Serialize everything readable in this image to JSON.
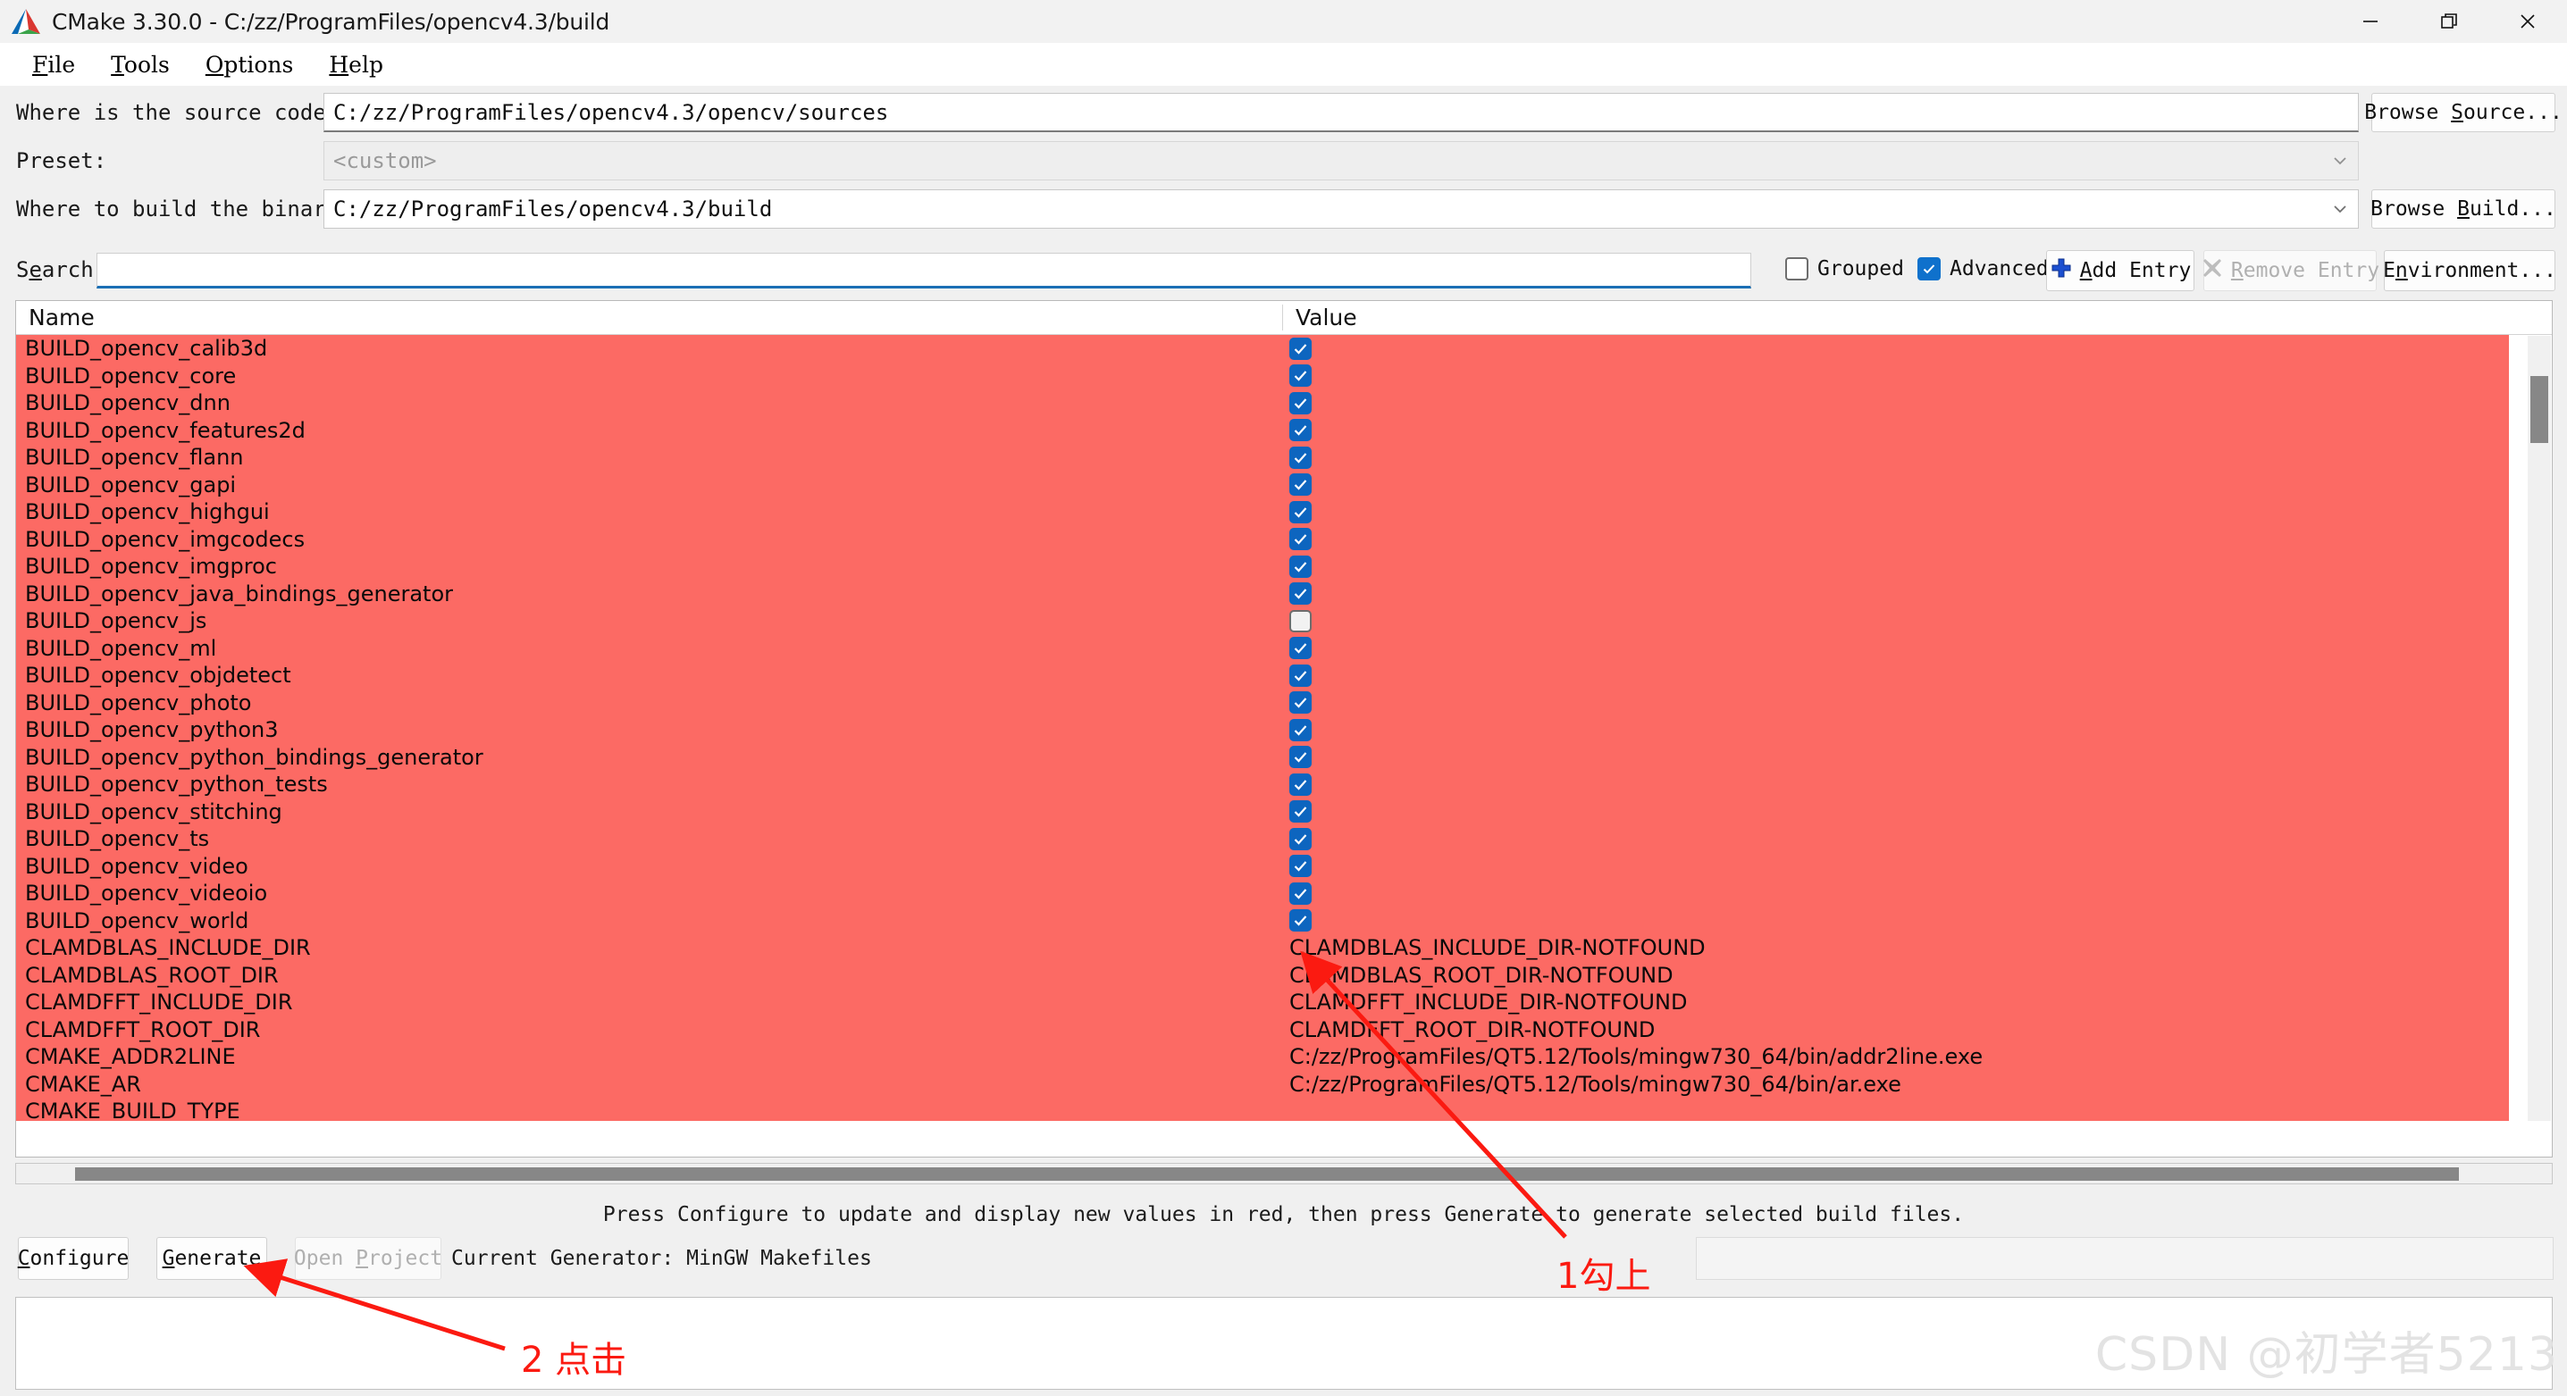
{
  "window": {
    "title": "CMake 3.30.0 - C:/zz/ProgramFiles/opencv4.3/build",
    "logo_icon": "cmake-logo-icon",
    "minimize_icon": "minimize-icon",
    "maximize_icon": "restore-icon",
    "close_icon": "close-icon"
  },
  "menu": {
    "items": [
      {
        "label": "File",
        "mnemonic": "F"
      },
      {
        "label": "Tools",
        "mnemonic": "T"
      },
      {
        "label": "Options",
        "mnemonic": "O"
      },
      {
        "label": "Help",
        "mnemonic": "H"
      }
    ]
  },
  "form": {
    "source_label": "Where is the source code:",
    "source_value": "C:/zz/ProgramFiles/opencv4.3/opencv/sources",
    "browse_source_label": "Browse Source...",
    "preset_label": "Preset:",
    "preset_value": "<custom>",
    "build_label": "Where to build the binaries:",
    "build_value": "C:/zz/ProgramFiles/opencv4.3/build",
    "browse_build_label": "Browse Build..."
  },
  "toolbar": {
    "search_label": "Search:",
    "search_value": "",
    "search_placeholder": "",
    "grouped_label": "Grouped",
    "grouped_checked": false,
    "advanced_label": "Advanced",
    "advanced_checked": true,
    "add_entry_label": "Add Entry",
    "add_entry_icon": "plus-icon",
    "remove_entry_label": "Remove Entry",
    "remove_entry_icon": "x-cross-icon",
    "remove_entry_disabled": true,
    "environment_label": "Environment..."
  },
  "table": {
    "columns": [
      "Name",
      "Value"
    ],
    "rows": [
      {
        "name": "BUILD_opencv_calib3d",
        "type": "bool",
        "checked": true,
        "value": ""
      },
      {
        "name": "BUILD_opencv_core",
        "type": "bool",
        "checked": true,
        "value": ""
      },
      {
        "name": "BUILD_opencv_dnn",
        "type": "bool",
        "checked": true,
        "value": ""
      },
      {
        "name": "BUILD_opencv_features2d",
        "type": "bool",
        "checked": true,
        "value": ""
      },
      {
        "name": "BUILD_opencv_flann",
        "type": "bool",
        "checked": true,
        "value": ""
      },
      {
        "name": "BUILD_opencv_gapi",
        "type": "bool",
        "checked": true,
        "value": ""
      },
      {
        "name": "BUILD_opencv_highgui",
        "type": "bool",
        "checked": true,
        "value": ""
      },
      {
        "name": "BUILD_opencv_imgcodecs",
        "type": "bool",
        "checked": true,
        "value": ""
      },
      {
        "name": "BUILD_opencv_imgproc",
        "type": "bool",
        "checked": true,
        "value": ""
      },
      {
        "name": "BUILD_opencv_java_bindings_generator",
        "type": "bool",
        "checked": true,
        "value": ""
      },
      {
        "name": "BUILD_opencv_js",
        "type": "bool",
        "checked": false,
        "value": ""
      },
      {
        "name": "BUILD_opencv_ml",
        "type": "bool",
        "checked": true,
        "value": ""
      },
      {
        "name": "BUILD_opencv_objdetect",
        "type": "bool",
        "checked": true,
        "value": ""
      },
      {
        "name": "BUILD_opencv_photo",
        "type": "bool",
        "checked": true,
        "value": ""
      },
      {
        "name": "BUILD_opencv_python3",
        "type": "bool",
        "checked": true,
        "value": ""
      },
      {
        "name": "BUILD_opencv_python_bindings_generator",
        "type": "bool",
        "checked": true,
        "value": ""
      },
      {
        "name": "BUILD_opencv_python_tests",
        "type": "bool",
        "checked": true,
        "value": ""
      },
      {
        "name": "BUILD_opencv_stitching",
        "type": "bool",
        "checked": true,
        "value": ""
      },
      {
        "name": "BUILD_opencv_ts",
        "type": "bool",
        "checked": true,
        "value": ""
      },
      {
        "name": "BUILD_opencv_video",
        "type": "bool",
        "checked": true,
        "value": ""
      },
      {
        "name": "BUILD_opencv_videoio",
        "type": "bool",
        "checked": true,
        "value": ""
      },
      {
        "name": "BUILD_opencv_world",
        "type": "bool",
        "checked": true,
        "value": ""
      },
      {
        "name": "CLAMDBLAS_INCLUDE_DIR",
        "type": "path",
        "value": "CLAMDBLAS_INCLUDE_DIR-NOTFOUND"
      },
      {
        "name": "CLAMDBLAS_ROOT_DIR",
        "type": "path",
        "value": "CLAMDBLAS_ROOT_DIR-NOTFOUND"
      },
      {
        "name": "CLAMDFFT_INCLUDE_DIR",
        "type": "path",
        "value": "CLAMDFFT_INCLUDE_DIR-NOTFOUND"
      },
      {
        "name": "CLAMDFFT_ROOT_DIR",
        "type": "path",
        "value": "CLAMDFFT_ROOT_DIR-NOTFOUND"
      },
      {
        "name": "CMAKE_ADDR2LINE",
        "type": "filepath",
        "value": "C:/zz/ProgramFiles/QT5.12/Tools/mingw730_64/bin/addr2line.exe"
      },
      {
        "name": "CMAKE_AR",
        "type": "filepath",
        "value": "C:/zz/ProgramFiles/QT5.12/Tools/mingw730_64/bin/ar.exe"
      },
      {
        "name": "CMAKE_BUILD_TYPE",
        "type": "string",
        "value": ""
      }
    ]
  },
  "footer": {
    "status_message": "Press Configure to update and display new values in red, then press Generate to generate selected build files.",
    "configure_label": "Configure",
    "generate_label": "Generate",
    "open_project_label": "Open Project",
    "open_project_disabled": true,
    "current_generator": "Current Generator: MinGW Makefiles"
  },
  "annotations": {
    "step1": "1勾上",
    "step2": "2 点击",
    "watermark": "CSDN @初学者5213",
    "color": "#fb1a11"
  },
  "colors": {
    "row_highlight_red": "#fc6a64",
    "checkbox_blue": "#0d65bf",
    "focus_blue": "#1b6fb5",
    "annotation_red": "#fb1a11"
  }
}
